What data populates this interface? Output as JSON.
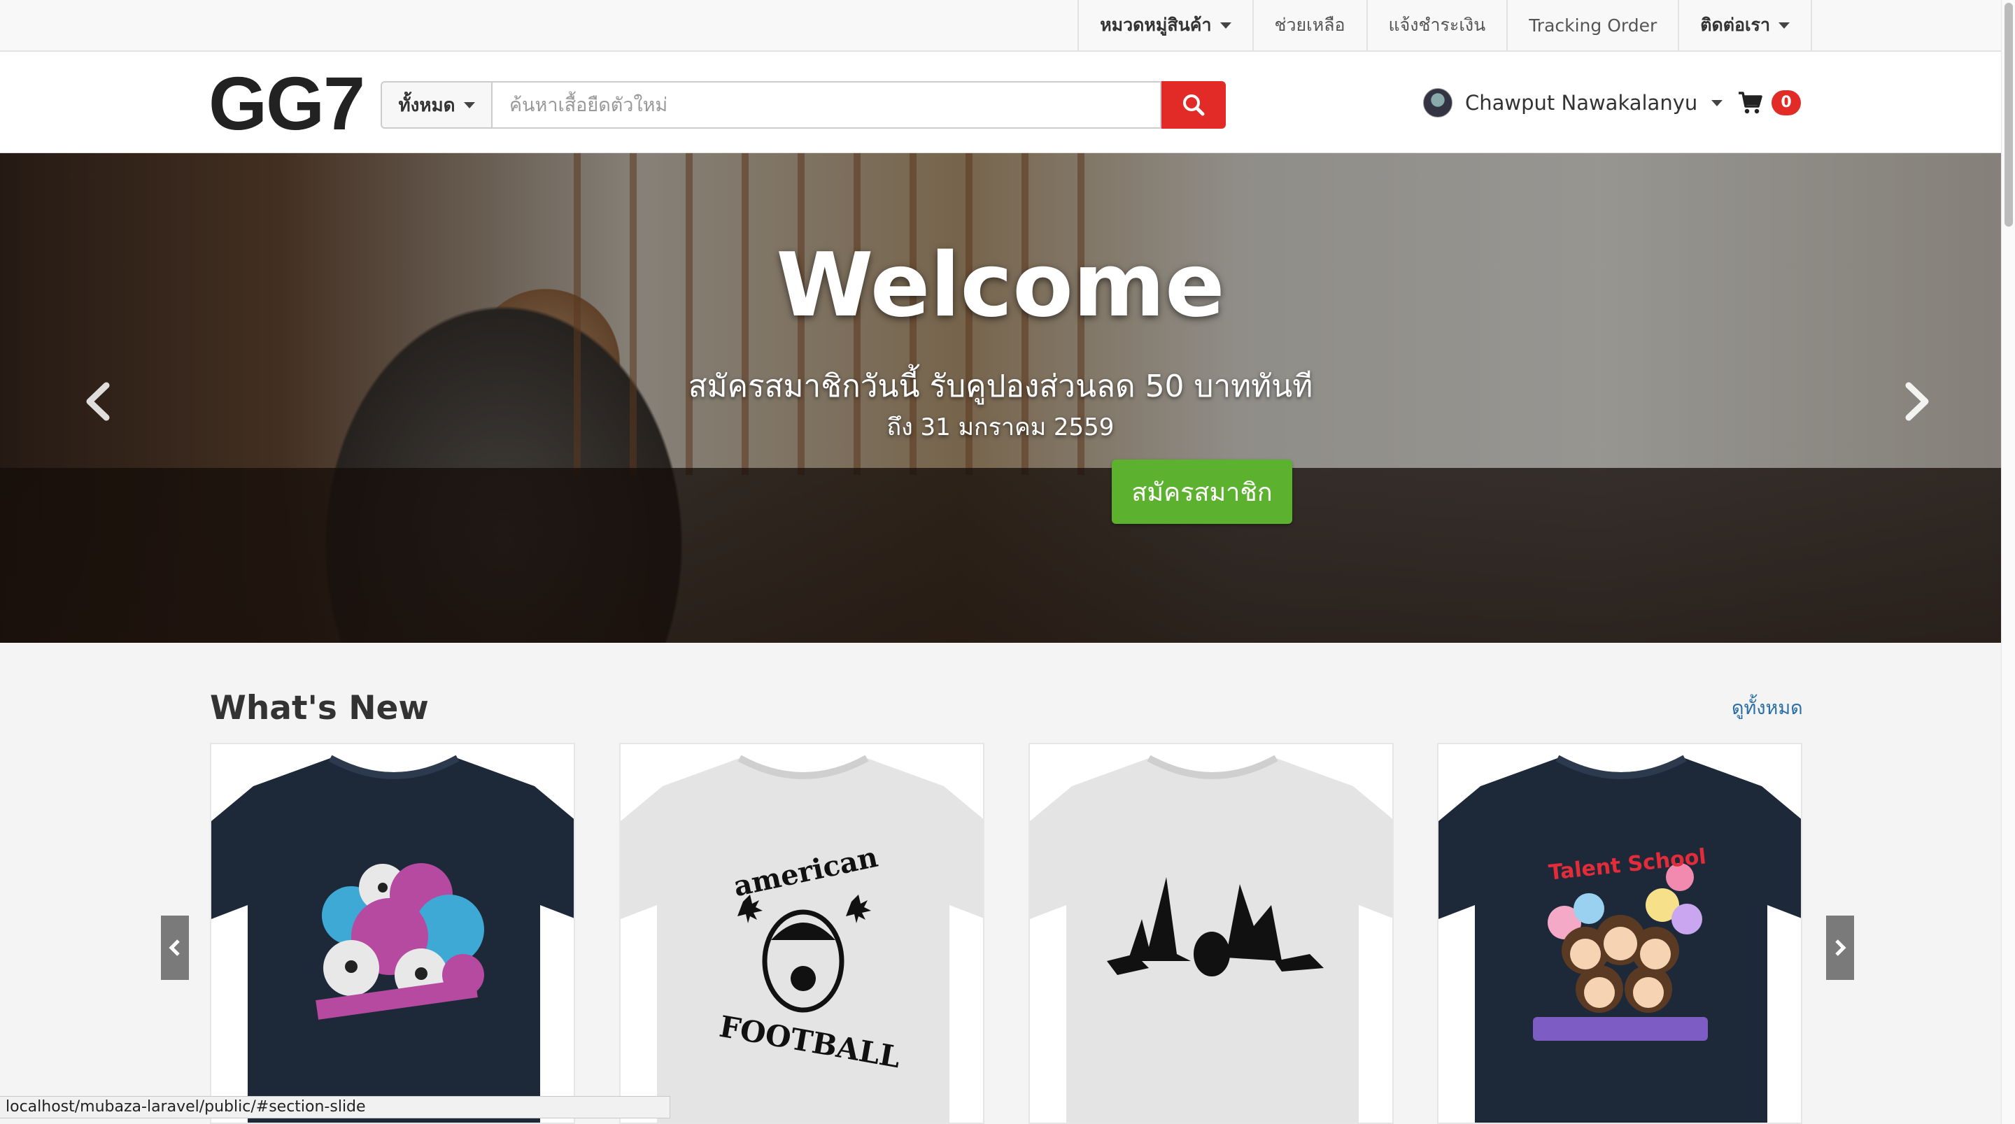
{
  "topnav": {
    "items": [
      {
        "label": "หมวดหมู่สินค้า",
        "dropdown": true
      },
      {
        "label": "ช่วยเหลือ",
        "dropdown": false
      },
      {
        "label": "แจ้งชำระเงิน",
        "dropdown": false
      },
      {
        "label": "Tracking Order",
        "dropdown": false
      },
      {
        "label": "ติดต่อเรา",
        "dropdown": true
      }
    ]
  },
  "header": {
    "logo": "GG7",
    "search": {
      "category": "ทั้งหมด",
      "placeholder": "ค้นหาเสื้อยืดตัวใหม่",
      "value": "",
      "button_icon": "search-icon"
    },
    "user": {
      "name": "Chawput Nawakalanyu"
    },
    "cart": {
      "count": "0",
      "icon": "cart-icon"
    }
  },
  "hero": {
    "title": "Welcome",
    "subtitle": "สมัครสมาชิกวันนี้ รับคูปองส่วนลด 50 บาททันที",
    "date": "ถึง 31 มกราคม 2559",
    "cta": "สมัครสมาชิก",
    "cta_color": "#5cb12f"
  },
  "whats_new": {
    "title": "What's New",
    "see_all": "ดูทั้งหมด",
    "products": [
      {
        "shirt_color": "#1d2838",
        "design": "monster-skulls"
      },
      {
        "shirt_color": "#e6e6e6",
        "design": "american-football"
      },
      {
        "shirt_color": "#e6e6e6",
        "design": "silhouette-face"
      },
      {
        "shirt_color": "#1d2838",
        "design": "talent-school"
      }
    ],
    "design_text": {
      "football_top": "american",
      "football_bottom": "FOOTBALL",
      "talent": "Talent School"
    }
  },
  "status_bar": {
    "url": "localhost/mubaza-laravel/public/#section-slide"
  },
  "colors": {
    "brand_red": "#e22a26",
    "link_blue": "#2a6fa8"
  }
}
